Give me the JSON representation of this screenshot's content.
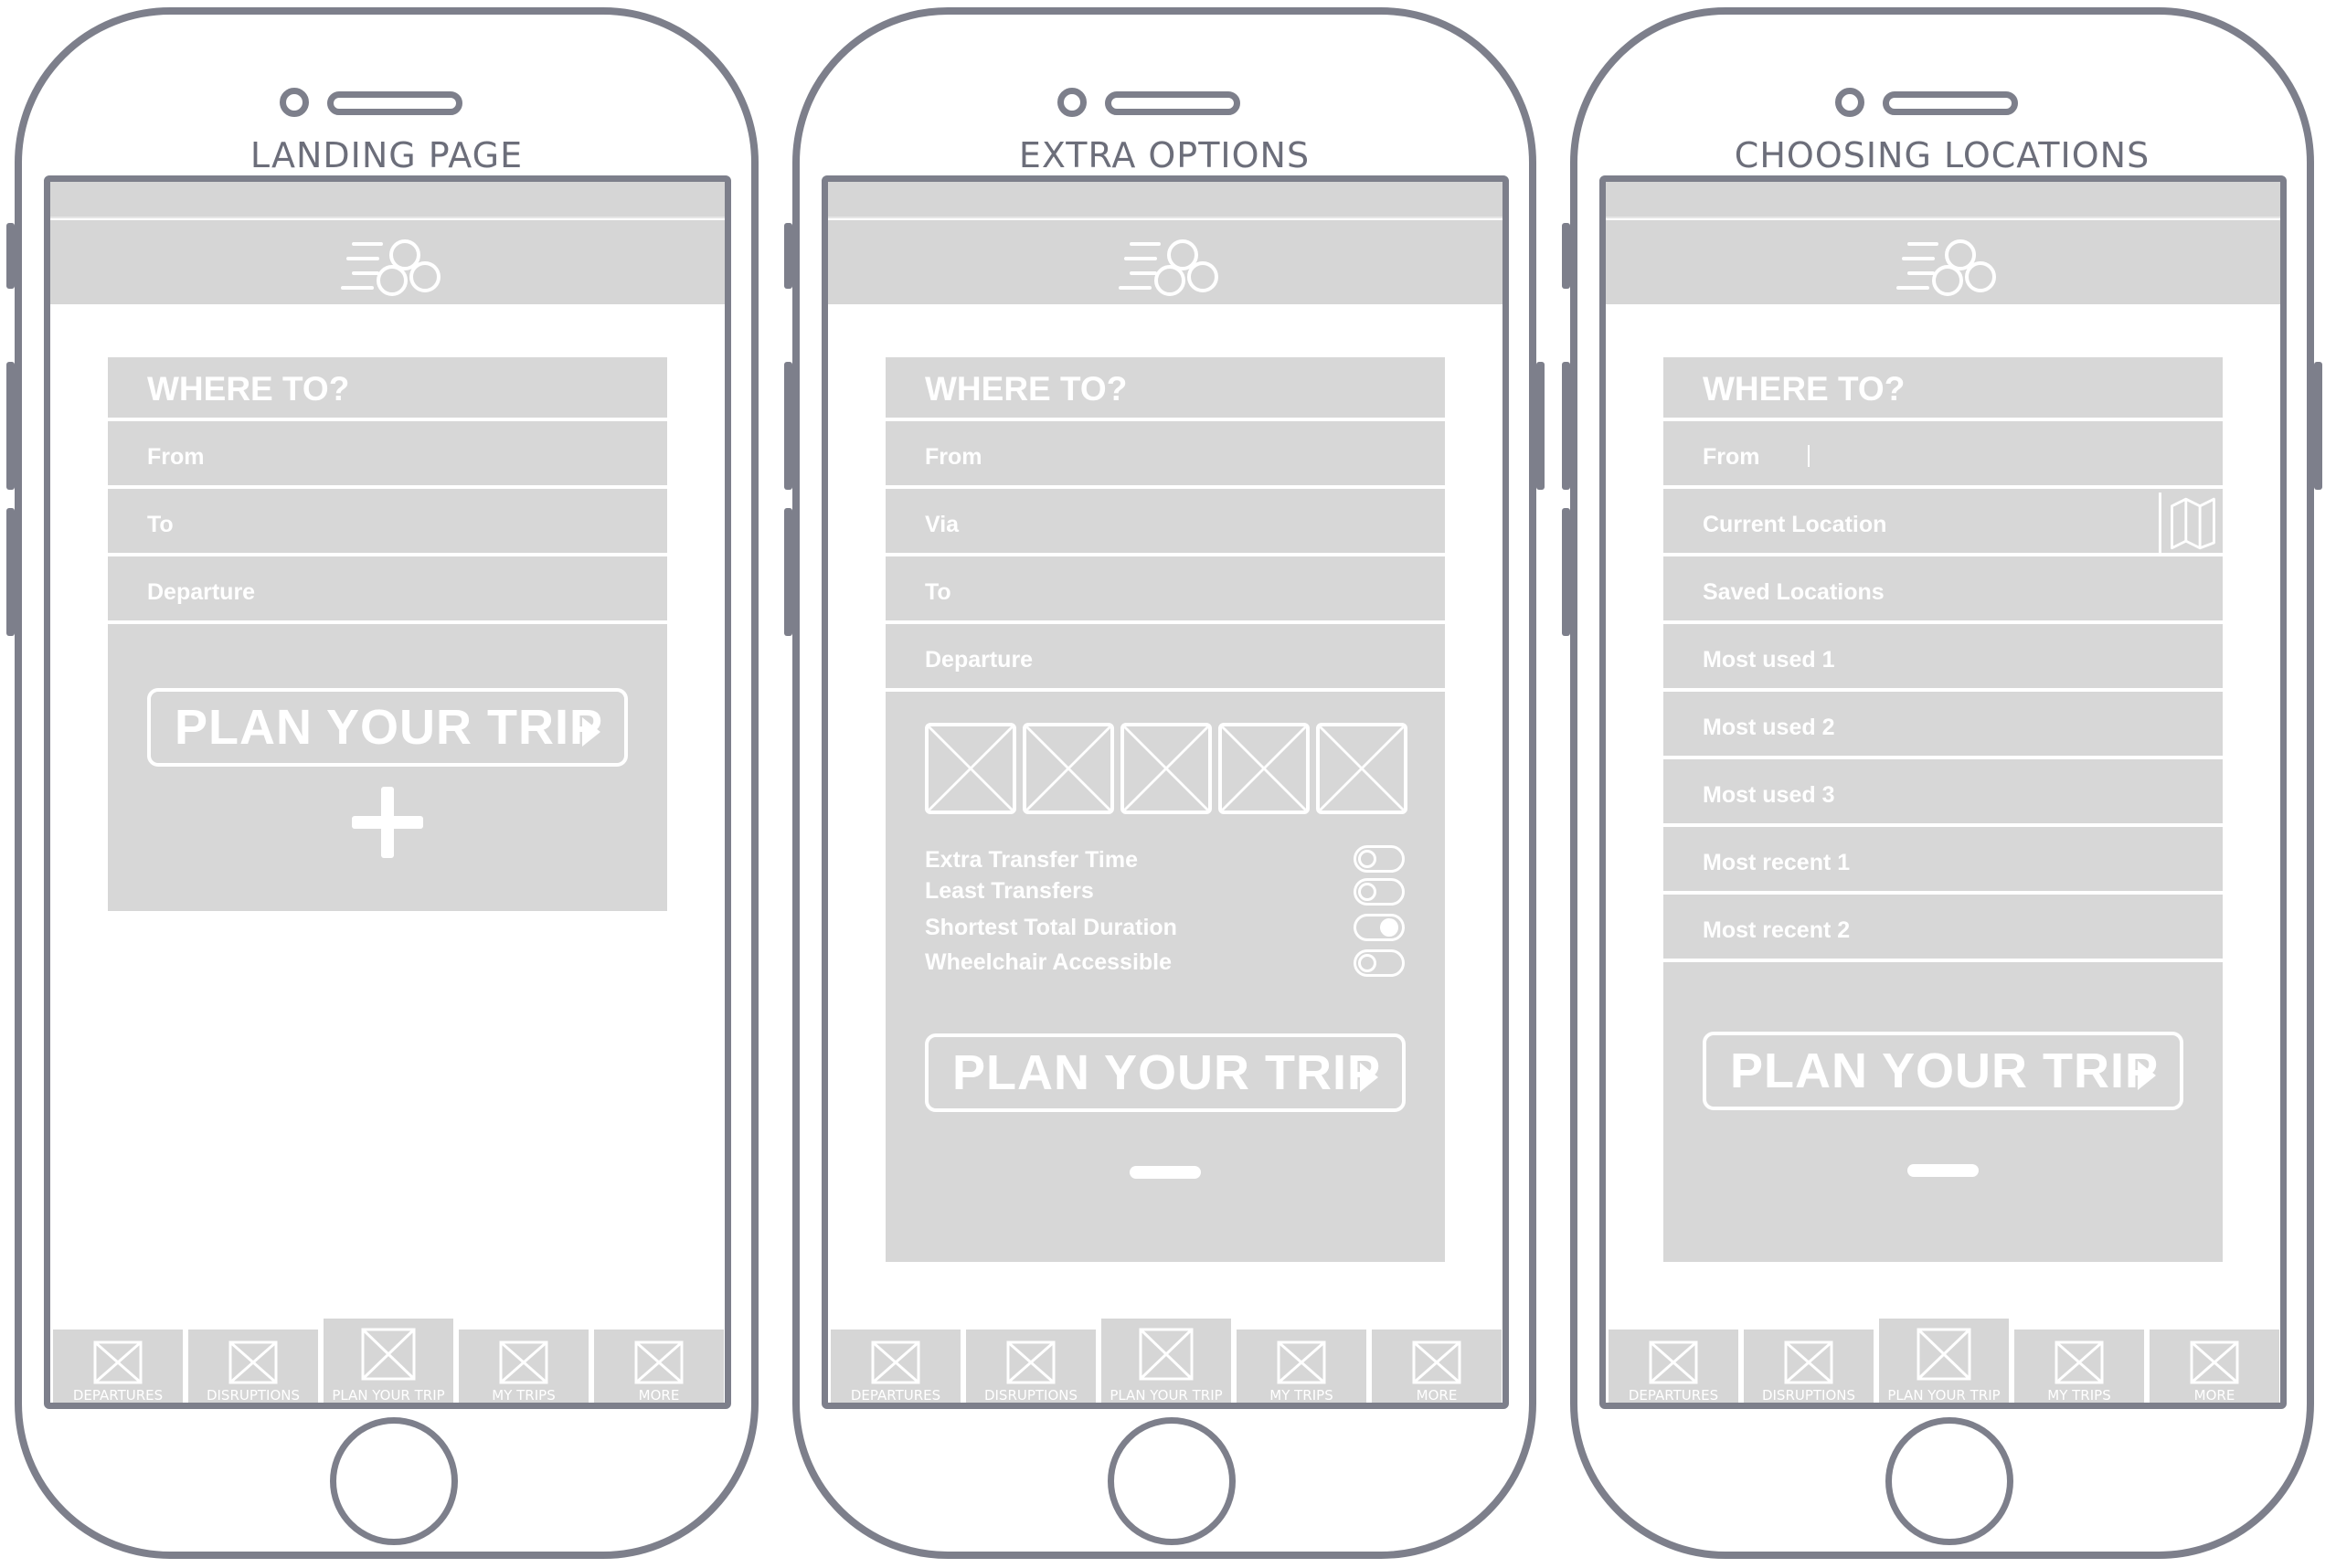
{
  "colors": {
    "outline": "#7d7f8b",
    "fill": "#d7d7d7",
    "title": "#6c6e7a",
    "text": "#ffffff"
  },
  "icons": {
    "logo": "bubbles-logo-icon",
    "placeholder": "image-placeholder-icon",
    "map": "map-icon",
    "expand": "plus-icon",
    "collapse": "minus-icon"
  },
  "phones": [
    {
      "title": "LANDING PAGE",
      "card": {
        "heading": "WHERE TO?",
        "fields": [
          "From",
          "To",
          "Departure"
        ]
      },
      "plan_button": "PLAN YOUR TRIP"
    },
    {
      "title": "EXTRA OPTIONS",
      "card": {
        "heading": "WHERE TO?",
        "fields": [
          "From",
          "Via",
          "To",
          "Departure"
        ]
      },
      "options": [
        {
          "label": "Extra Transfer Time",
          "on": false
        },
        {
          "label": "Least Transfers",
          "on": false
        },
        {
          "label": "Shortest Total Duration",
          "on": true
        },
        {
          "label": "Wheelchair Accessible",
          "on": false
        }
      ],
      "plan_button": "PLAN YOUR TRIP"
    },
    {
      "title": "CHOOSING LOCATIONS",
      "card": {
        "heading": "WHERE TO?",
        "fields": [
          "From",
          "Current Location",
          "Saved Locations",
          "Most used 1",
          "Most used 2",
          "Most used 3",
          "Most recent 1",
          "Most recent 2"
        ]
      },
      "plan_button": "PLAN YOUR TRIP"
    }
  ],
  "tabs": [
    "DEPARTURES",
    "DISRUPTIONS",
    "PLAN YOUR TRIP",
    "MY TRIPS",
    "MORE"
  ],
  "active_tab": "PLAN YOUR TRIP"
}
